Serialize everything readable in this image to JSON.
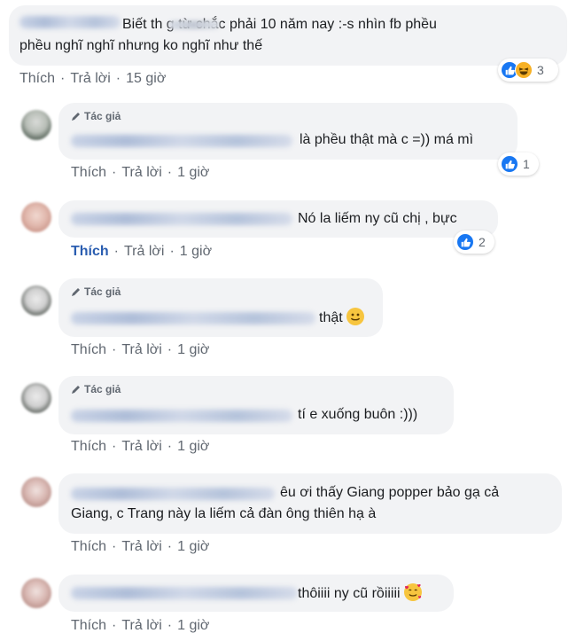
{
  "comments": [
    {
      "text_line1": "Biết th         g từ chắc phải 10 năm nay :-s nhìn fb phều",
      "text_line2": "phều nghĩ nghĩ nhưng ko nghĩ như thế",
      "actions": {
        "like": "Thích",
        "reply": "Trả lời",
        "time": "15 giờ"
      },
      "reactions": {
        "count": "3",
        "types": [
          "like-icon",
          "haha-icon"
        ]
      }
    },
    {
      "author_tag": "Tác giả",
      "text": "là phều thật mà c =)) má mì",
      "actions": {
        "like": "Thích",
        "reply": "Trả lời",
        "time": "1 giờ"
      },
      "reactions": {
        "count": "1",
        "types": [
          "like-icon"
        ]
      }
    },
    {
      "text": "Nó la liếm ny cũ chị , bực",
      "actions": {
        "like": "Thích",
        "reply": "Trả lời",
        "time": "1 giờ"
      },
      "reactions": {
        "count": "2",
        "types": [
          "like-icon"
        ]
      }
    },
    {
      "author_tag": "Tác giả",
      "text": "thật",
      "emoji": "smiling-face-icon",
      "actions": {
        "like": "Thích",
        "reply": "Trả lời",
        "time": "1 giờ"
      }
    },
    {
      "author_tag": "Tác giả",
      "text": "tí e xuống buôn :)))",
      "actions": {
        "like": "Thích",
        "reply": "Trả lời",
        "time": "1 giờ"
      }
    },
    {
      "text_line1": "êu ơi thấy Giang popper bảo gạ cả",
      "text_line2": "Giang, c Trang này la liếm cả đàn ông thiên hạ à",
      "actions": {
        "like": "Thích",
        "reply": "Trả lời",
        "time": "1 giờ"
      }
    },
    {
      "text": "thôiiii ny cũ rồiiiii",
      "emoji": "smiling-face-with-hearts-icon",
      "actions": {
        "like": "Thích",
        "reply": "Trả lời",
        "time": "1 giờ"
      }
    }
  ],
  "colors": {
    "like_blue": "#1877f2",
    "bubble_bg": "#f2f3f5",
    "link_active": "#2a5db0"
  }
}
